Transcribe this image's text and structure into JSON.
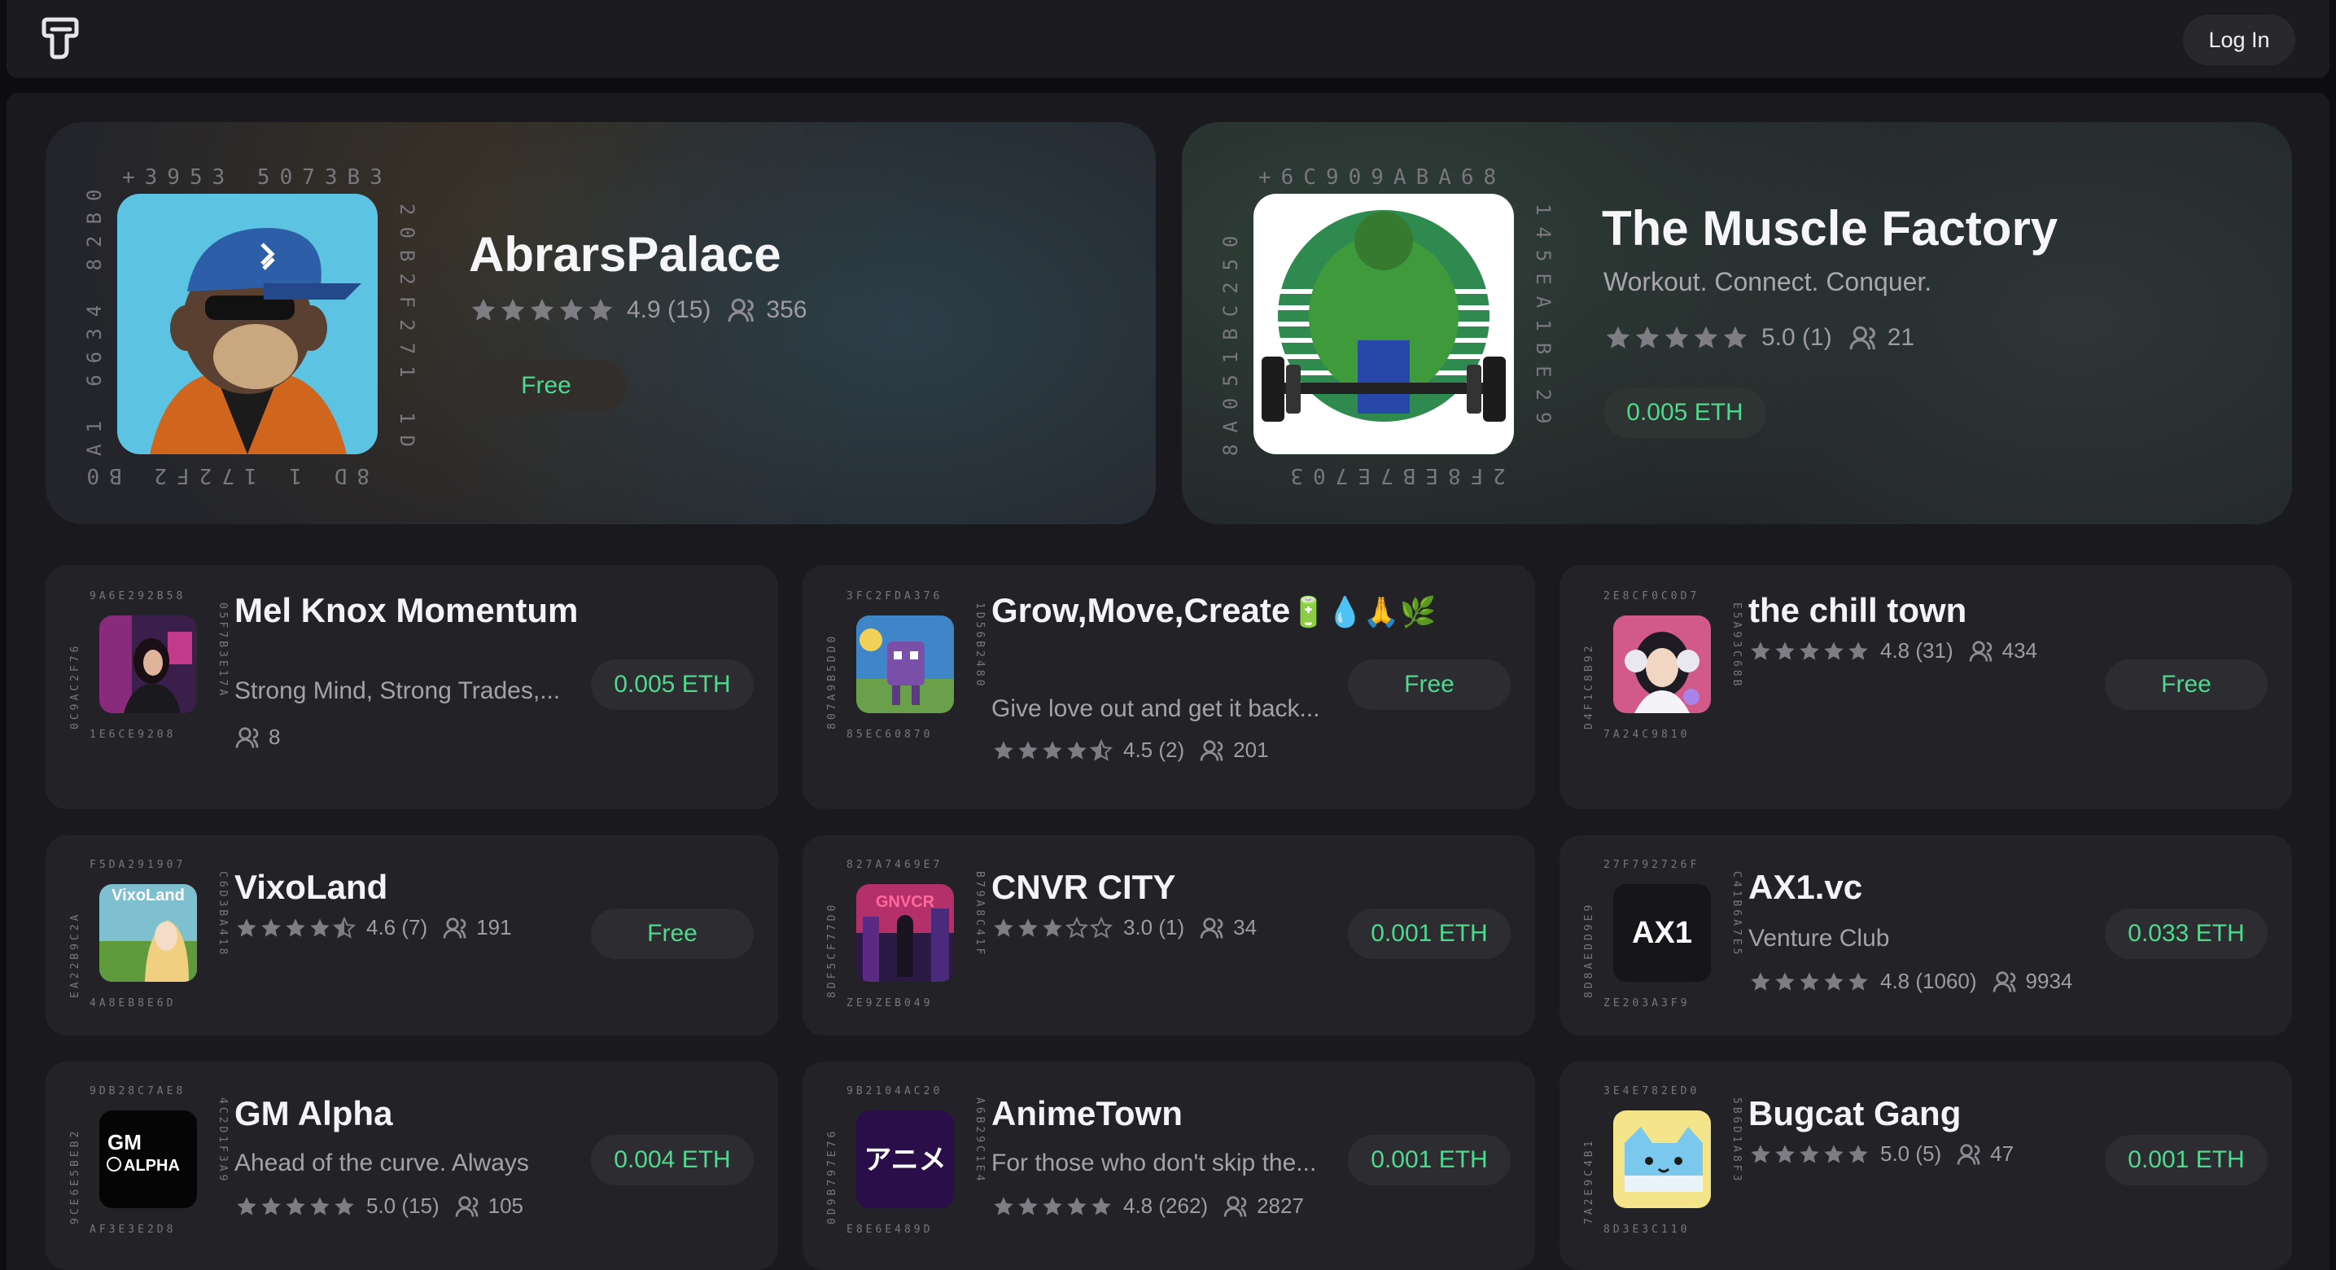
{
  "header": {
    "login_label": "Log In"
  },
  "featured": [
    {
      "name": "AbrarsPalace",
      "subtitle": "",
      "rating": "4.9 (15)",
      "members": "356",
      "price": "Free",
      "ring_code": "395350 73B3 20B2F271 1D8 2066 1F10 9A1 66 34 82B0 +"
    },
    {
      "name": "The Muscle Factory",
      "subtitle": "Workout. Connect. Conquer.",
      "rating": "5.0 (1)",
      "members": "21",
      "price": "0.005 ETH",
      "ring_code": "6C909ABA6 8145EA1BE29 FE8S7E703 8A051BC2 50+"
    }
  ],
  "cards": [
    {
      "name": "Mel Knox Momentum",
      "desc": "Strong Mind, Strong Trades,...",
      "rating": "",
      "members": "8",
      "price": "0.005 ETH"
    },
    {
      "name": "Grow,Move,Create",
      "emoji": "🔋💧🙏🌿",
      "desc": "Give love out and get it back...",
      "rating": "4.5 (2)",
      "members": "201",
      "price": "Free"
    },
    {
      "name": "the chill town",
      "desc": "",
      "rating": "4.8 (31)",
      "members": "434",
      "price": "Free"
    },
    {
      "name": "VixoLand",
      "desc": "",
      "rating": "4.6 (7)",
      "members": "191",
      "price": "Free"
    },
    {
      "name": "CNVR CITY",
      "desc": "",
      "rating": "3.0 (1)",
      "members": "34",
      "price": "0.001 ETH"
    },
    {
      "name": "AX1.vc",
      "desc": "Venture Club",
      "rating": "4.8 (1060)",
      "members": "9934",
      "price": "0.033 ETH"
    },
    {
      "name": "GM Alpha",
      "desc": "Ahead of the curve. Always",
      "rating": "5.0 (15)",
      "members": "105",
      "price": "0.004 ETH"
    },
    {
      "name": "AnimeTown",
      "desc": "For those who don't skip the...",
      "rating": "4.8 (262)",
      "members": "2827",
      "price": "0.001 ETH"
    },
    {
      "name": "Bugcat Gang",
      "desc": "",
      "rating": "5.0 (5)",
      "members": "47",
      "price": "0.001 ETH"
    }
  ],
  "thumb_text": {
    "vixoland": "VixoLand",
    "cnvr": "GNVCR",
    "ax1": "AX1",
    "gm": "GM",
    "gm_sub": "ALPHA",
    "anime": "アニメ"
  },
  "colors": {
    "price_green": "#4fd98f",
    "background": "#1a1a1e",
    "card": "#232327"
  }
}
